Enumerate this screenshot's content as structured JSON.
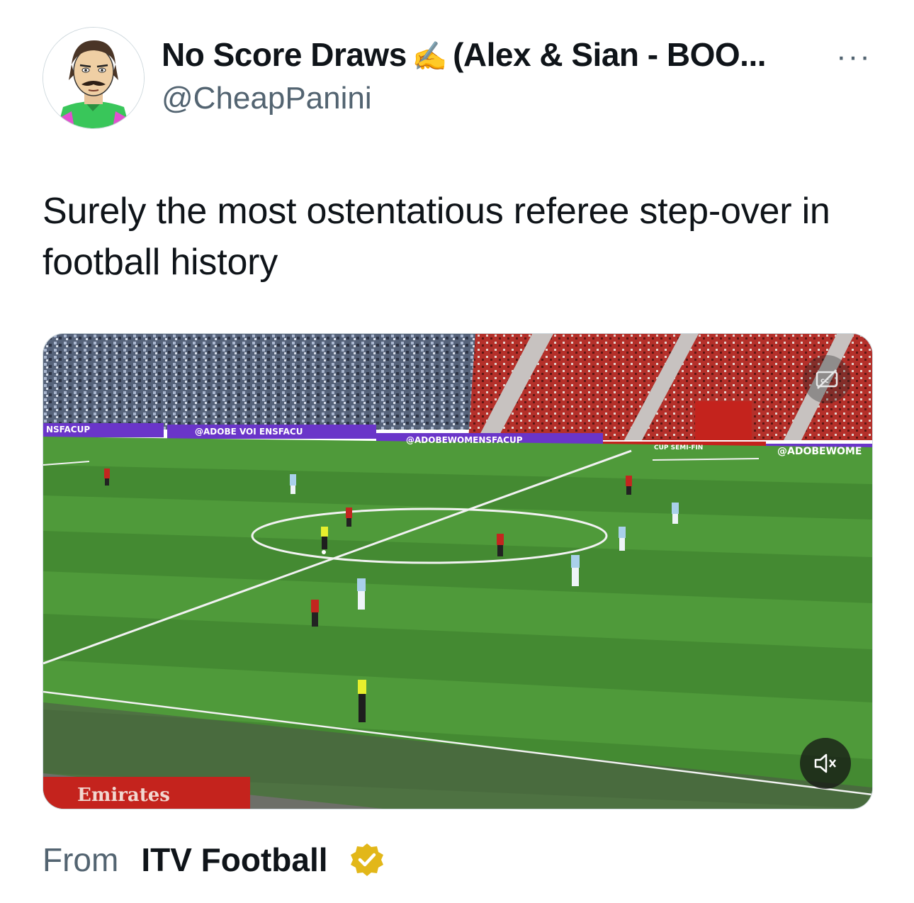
{
  "author": {
    "display_name": "No Score Draws",
    "name_emoji": "✍️",
    "name_suffix": "(Alex & Sian - BOO...",
    "handle": "@CheapPanini",
    "avatar_icon": "cartoon-goalkeeper-avatar"
  },
  "menu": {
    "more_label": "···"
  },
  "tweet": {
    "text": "Surely the most ostentatious referee step-over in football history"
  },
  "media": {
    "type": "video",
    "captions_icon": "captions-off-icon",
    "mute_icon": "speaker-muted-icon",
    "boards": {
      "left": "NSFACUP",
      "center_left": "@ADOBE VOI ENSFACU",
      "center": "@ADOBEWOMENSFACUP",
      "right": "@ADOBEWOME",
      "cup": "CUP SEMI-FIN",
      "sponsor": "Emirates"
    }
  },
  "source": {
    "from_label": "From",
    "name": "ITV Football",
    "verified_icon": "gold-verified-badge-icon",
    "badge_color": "#e2b719"
  },
  "colors": {
    "pitch_light": "#4f9a3a",
    "pitch_dark": "#448a32",
    "board_purple": "#6a35c9",
    "crowd_red": "#b4302a",
    "text_secondary": "#536471"
  }
}
